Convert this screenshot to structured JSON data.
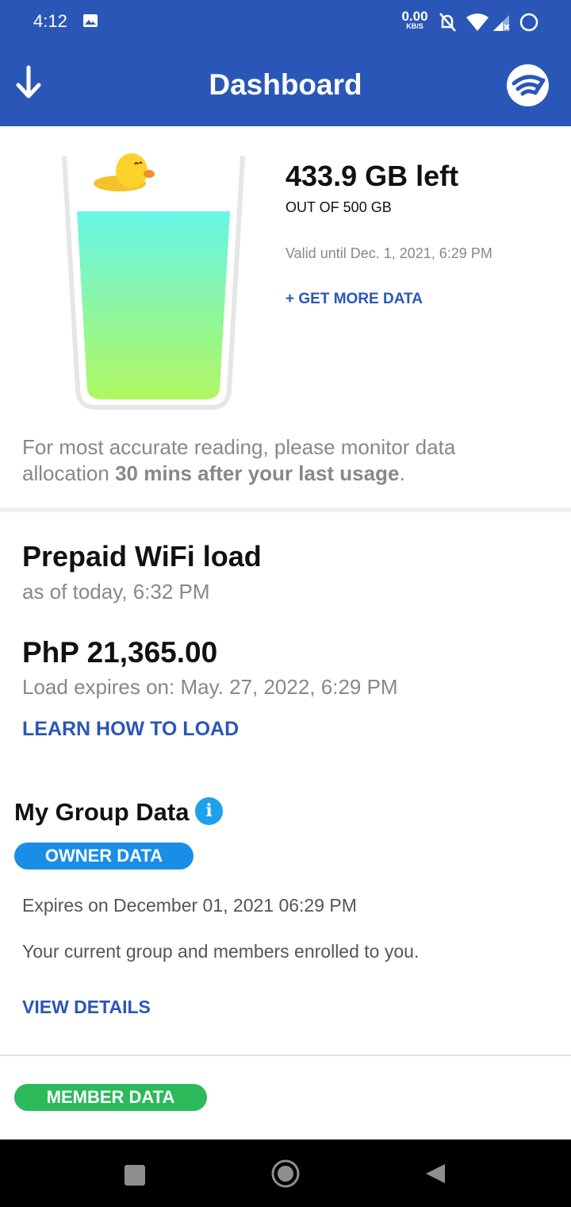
{
  "status_bar": {
    "time": "4:12",
    "speed_value": "0.00",
    "speed_unit": "KB/S",
    "icons": [
      "image-icon",
      "mute-icon",
      "wifi-signal-icon",
      "cell-signal-icon",
      "loading-icon"
    ]
  },
  "app_bar": {
    "title": "Dashboard",
    "left_icon": "down-arrow-icon",
    "right_icon": "wifi-logo-icon"
  },
  "data_usage": {
    "remaining": "433.9 GB left",
    "total": "OUT OF 500 GB",
    "valid_until": "Valid until Dec. 1, 2021, 6:29 PM",
    "get_more": "+ GET MORE DATA",
    "remaining_fraction": 0.868,
    "note_prefix": "For most accurate reading, please monitor data allocation ",
    "note_bold": "30 mins after your last usage",
    "note_suffix": "."
  },
  "prepaid_load": {
    "title": "Prepaid WiFi load",
    "as_of": "as of today, 6:32 PM",
    "amount": "PhP 21,365.00",
    "expires": "Load expires on: May. 27, 2022, 6:29 PM",
    "learn_link": "LEARN HOW TO LOAD"
  },
  "group_data": {
    "title": "My Group Data",
    "info_icon": "info-icon",
    "owner_label": "OWNER DATA",
    "owner_expires": "Expires on December 01, 2021 06:29 PM",
    "owner_desc": "Your current group and members enrolled to you.",
    "view_details": "VIEW DETAILS",
    "member_label": "MEMBER DATA"
  },
  "nav_bar": {
    "icons": [
      "recents-icon",
      "home-icon",
      "back-icon"
    ]
  }
}
